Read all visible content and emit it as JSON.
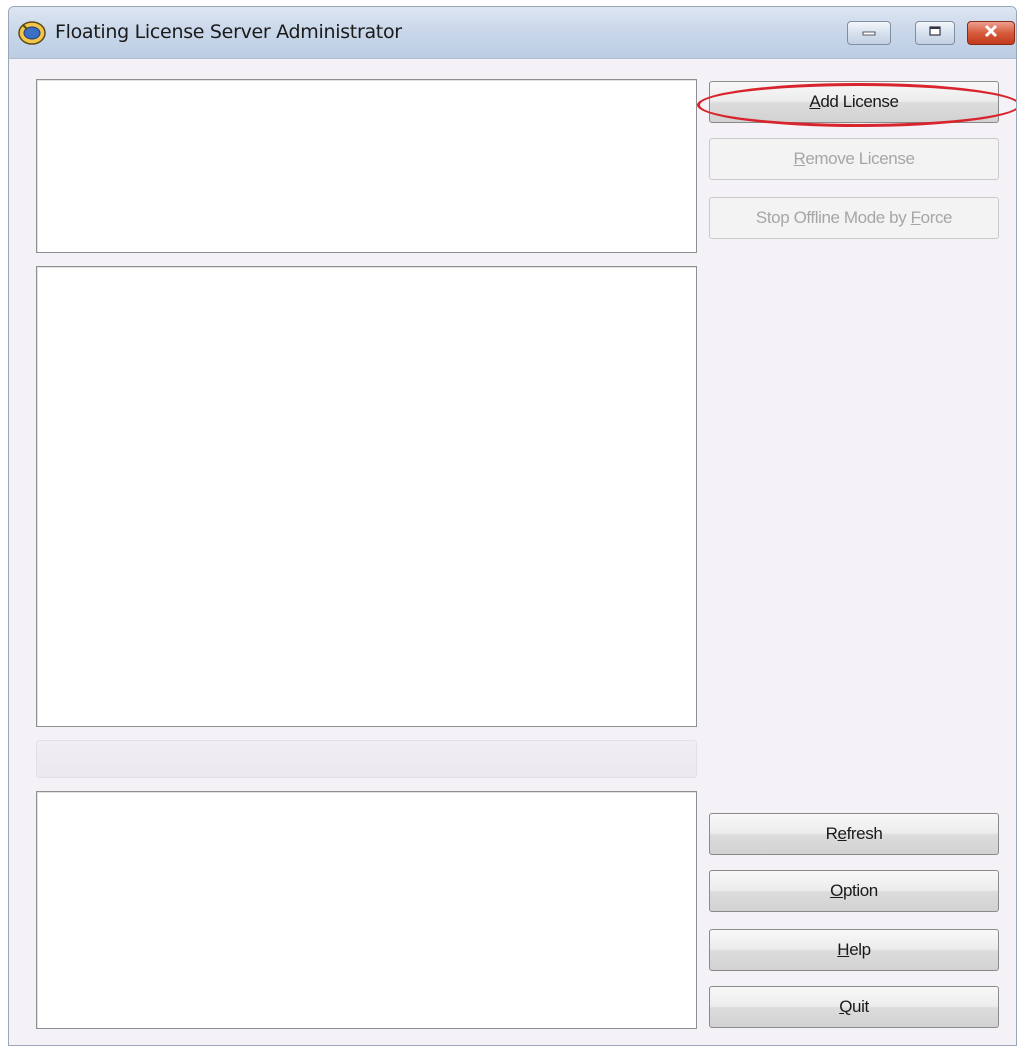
{
  "window": {
    "title": "Floating License Server Administrator"
  },
  "buttons": {
    "add_license": {
      "accel": "A",
      "rest": "dd License",
      "enabled": true
    },
    "remove_license": {
      "accel": "R",
      "rest": "emove License",
      "enabled": false
    },
    "stop_offline": {
      "pre": "Stop Offline Mode by ",
      "accel": "F",
      "rest": "orce",
      "enabled": false
    },
    "refresh": {
      "pre": "R",
      "accel": "e",
      "rest": "fresh",
      "enabled": true
    },
    "option": {
      "accel": "O",
      "rest": "ption",
      "enabled": true
    },
    "help": {
      "accel": "H",
      "rest": "elp",
      "enabled": true
    },
    "quit": {
      "accel": "Q",
      "rest": "uit",
      "enabled": true
    }
  },
  "annotation": {
    "highlight_color": "#d8242c",
    "highlighted_element": "add-license-button"
  },
  "colors": {
    "window_bg": "#f4f2f7",
    "titlebar": "#cad8ea",
    "close_button": "#d65a3c"
  },
  "icons": {
    "app": "floating-license-icon",
    "minimize": "minimize-icon",
    "maximize": "maximize-icon",
    "close": "close-icon"
  }
}
